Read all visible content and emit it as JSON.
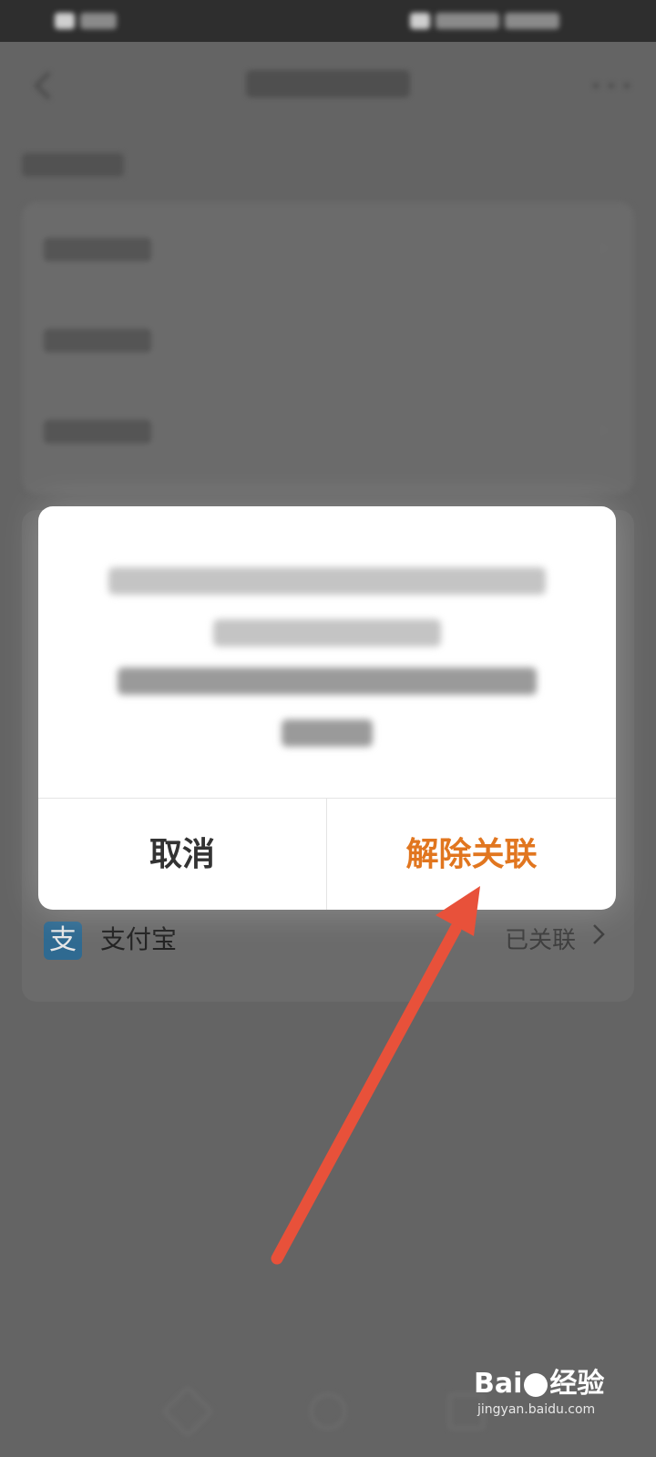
{
  "dialog": {
    "cancel_label": "取消",
    "confirm_label": "解除关联",
    "confirm_color": "#e1761f"
  },
  "linked_account": {
    "label": "支付宝",
    "logo_char": "支",
    "status": "已关联",
    "logo_color": "#2f6a91"
  },
  "annotation": {
    "arrow_color": "#e8513a"
  },
  "watermark": {
    "brand": "Bai",
    "brand_suffix": "经验",
    "url": "jingyan.baidu.com"
  }
}
